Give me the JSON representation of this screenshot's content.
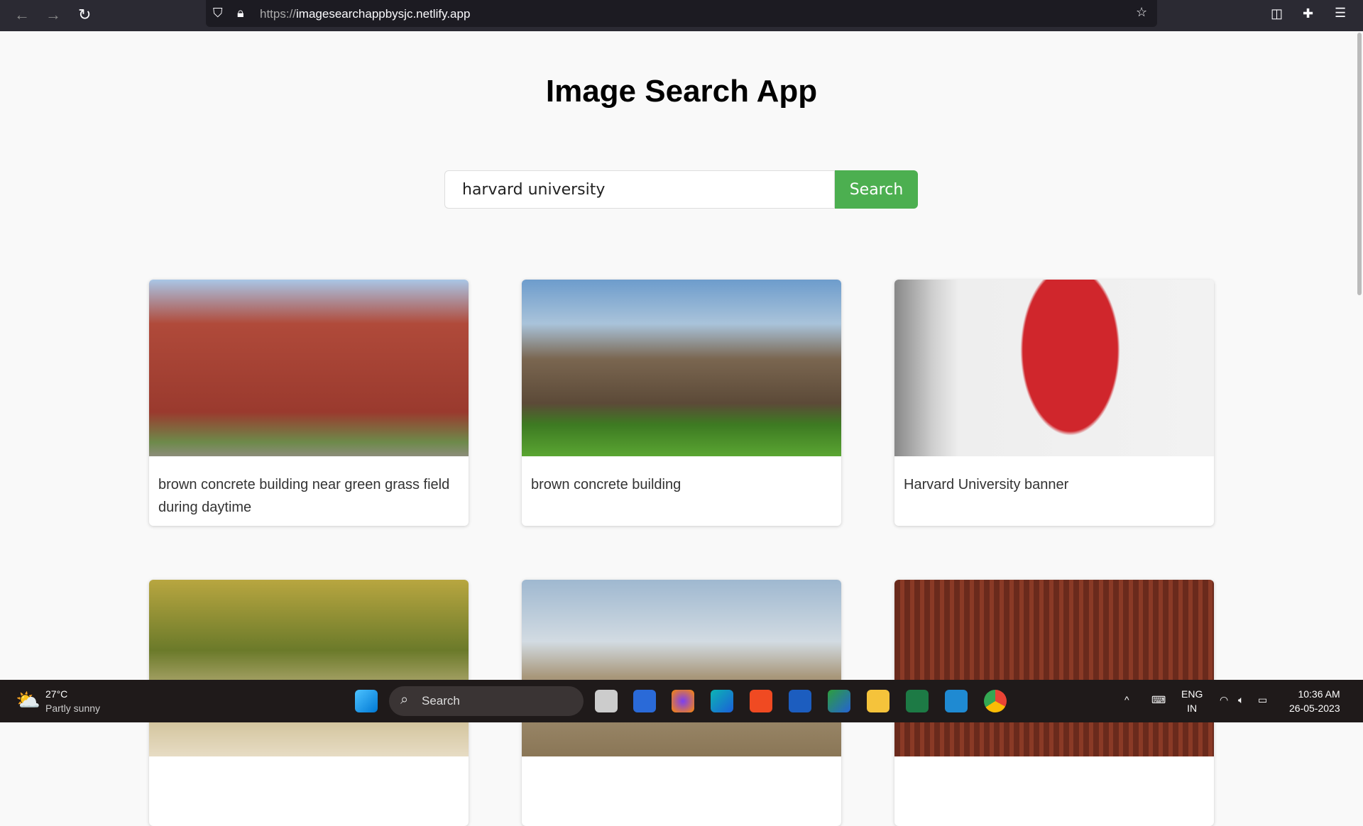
{
  "browser": {
    "url_prefix": "https://",
    "url_host": "imagesearchappbysjc.netlify.app"
  },
  "page": {
    "title": "Image Search App",
    "search_value": "harvard university",
    "search_button": "Search"
  },
  "results": [
    {
      "caption": "brown concrete building near green grass field during daytime"
    },
    {
      "caption": "brown concrete building"
    },
    {
      "caption": "Harvard University banner"
    },
    {
      "caption": ""
    },
    {
      "caption": ""
    },
    {
      "caption": ""
    }
  ],
  "taskbar": {
    "weather_temp": "27°C",
    "weather_desc": "Partly sunny",
    "search": "Search",
    "lang1": "ENG",
    "lang2": "IN",
    "time": "10:36 AM",
    "date": "26-05-2023"
  }
}
